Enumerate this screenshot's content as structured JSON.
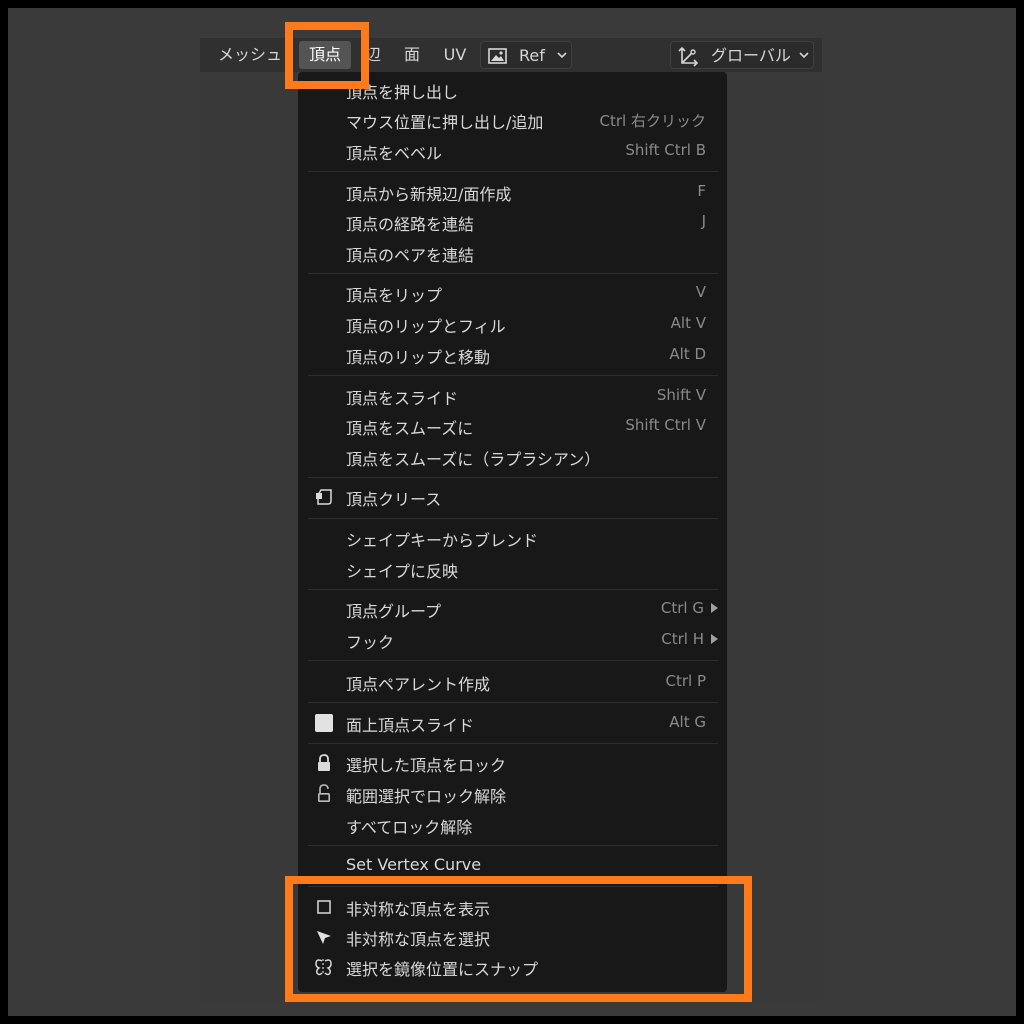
{
  "header": {
    "menus": [
      "メッシュ",
      "頂点",
      "辺",
      "面",
      "UV"
    ],
    "ref_dropdown_label": "Ref",
    "transform_dropdown_label": "グローバル"
  },
  "menu": {
    "items": [
      {
        "label": "頂点を押し出し",
        "shortcut": ""
      },
      {
        "label": "マウス位置に押し出し/追加",
        "shortcut": "Ctrl 右クリック"
      },
      {
        "label": "頂点をベベル",
        "shortcut": "Shift Ctrl B"
      },
      {
        "label": "頂点から新規辺/面作成",
        "shortcut": "F"
      },
      {
        "label": "頂点の経路を連結",
        "shortcut": "J"
      },
      {
        "label": "頂点のペアを連結",
        "shortcut": ""
      },
      {
        "label": "頂点をリップ",
        "shortcut": "V"
      },
      {
        "label": "頂点のリップとフィル",
        "shortcut": "Alt V"
      },
      {
        "label": "頂点のリップと移動",
        "shortcut": "Alt D"
      },
      {
        "label": "頂点をスライド",
        "shortcut": "Shift V"
      },
      {
        "label": "頂点をスムーズに",
        "shortcut": "Shift Ctrl V"
      },
      {
        "label": "頂点をスムーズに（ラプラシアン）",
        "shortcut": ""
      },
      {
        "label": "頂点クリース",
        "shortcut": "",
        "icon": "crease-icon"
      },
      {
        "label": "シェイプキーからブレンド",
        "shortcut": ""
      },
      {
        "label": "シェイプに反映",
        "shortcut": ""
      },
      {
        "label": "頂点グループ",
        "shortcut": "Ctrl G",
        "submenu": true
      },
      {
        "label": "フック",
        "shortcut": "Ctrl H",
        "submenu": true
      },
      {
        "label": "頂点ペアレント作成",
        "shortcut": "Ctrl P"
      },
      {
        "label": "面上頂点スライド",
        "shortcut": "Alt G",
        "icon": "square-filled-icon"
      },
      {
        "label": "選択した頂点をロック",
        "shortcut": "",
        "icon": "lock-icon"
      },
      {
        "label": "範囲選択でロック解除",
        "shortcut": "",
        "icon": "unlock-icon"
      },
      {
        "label": "すべてロック解除",
        "shortcut": ""
      },
      {
        "label": "Set Vertex Curve",
        "shortcut": ""
      },
      {
        "label": "非対称な頂点を表示",
        "shortcut": "",
        "icon": "square-outline-icon"
      },
      {
        "label": "非対称な頂点を選択",
        "shortcut": "",
        "icon": "cursor-arrow-icon"
      },
      {
        "label": "選択を鏡像位置にスナップ",
        "shortcut": "",
        "icon": "mirror-snap-icon"
      }
    ]
  },
  "colors": {
    "highlight": "#ff7a1a",
    "menu_bg": "#181818",
    "viewport_bg": "#393939"
  }
}
